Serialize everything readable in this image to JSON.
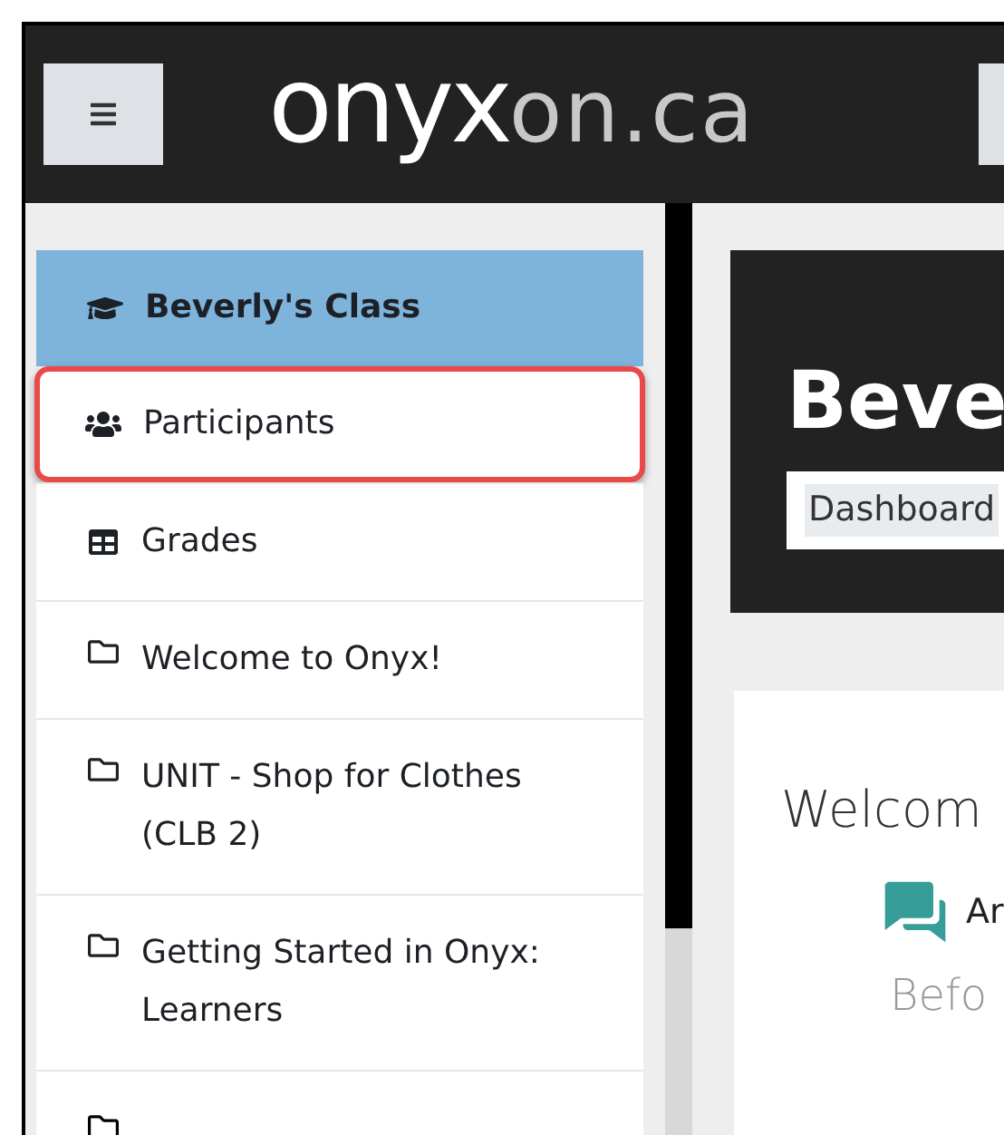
{
  "header": {
    "logo": {
      "main": "onyx",
      "suffix": "on.ca"
    }
  },
  "sidebar": {
    "items": [
      {
        "kind": "course",
        "label": "Beverly's Class",
        "selected": true,
        "highlighted": false
      },
      {
        "kind": "participants",
        "label": "Participants",
        "selected": false,
        "highlighted": true
      },
      {
        "kind": "grades",
        "label": "Grades",
        "selected": false,
        "highlighted": false
      },
      {
        "kind": "folder",
        "label": "Welcome to Onyx!",
        "selected": false,
        "highlighted": false
      },
      {
        "kind": "folder",
        "label": "UNIT - Shop for Clothes (CLB 2)",
        "selected": false,
        "highlighted": false
      },
      {
        "kind": "folder",
        "label": "Getting Started in Onyx: Learners",
        "selected": false,
        "highlighted": false
      }
    ]
  },
  "page_header": {
    "title": "Beve",
    "breadcrumb": "Dashboard"
  },
  "content": {
    "heading": "Welcom",
    "forum_label": "Ar",
    "subheading": "Befo"
  }
}
